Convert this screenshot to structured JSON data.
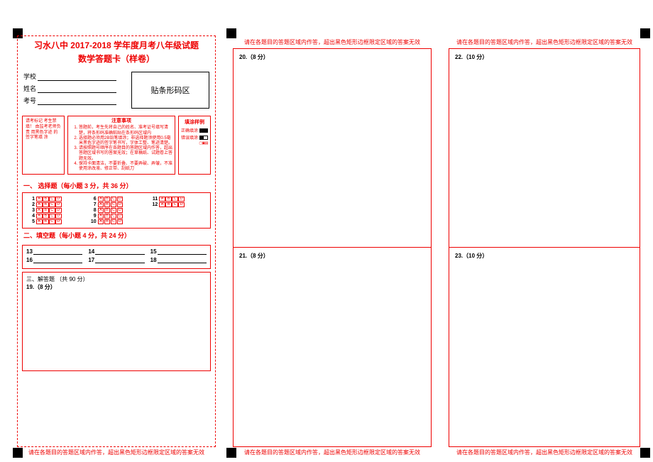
{
  "title_line1": "习水八中 2017-2018 学年度月考八年级试题",
  "title_line2": "数学答题卡（样卷）",
  "info": {
    "school_label": "学校",
    "name_label": "姓名",
    "examno_label": "考号"
  },
  "barcode_label": "贴条形码区",
  "instr_left": "请考标记 考生禁填！ 由监考老师负责 用黑色字迹 的签字笔填 涂",
  "instr_mid_title": "注意事项",
  "instr_mid": [
    "答题前，考生先将自己的姓名、准考证号填写清楚，将条形码准确粘贴在条形码区域内",
    "选择题必须用2B铅笔填涂；非选择题须使用0.5毫米黑色字迹的签字笔书写，字体工整、笔迹清楚。",
    "请按照题号顺序在各题目的答题区域内作答，超出答题区域书写的答案无效；在草稿纸、试题卷上答题无效。",
    "保持卡面清洁，不要折叠、不要弄破、弄皱，不准使用涂改液、修正带、刮纸刀"
  ],
  "instr_right_title": "填涂样例",
  "fill_examples": {
    "correct": "正确填涂",
    "wrong": "错误填涂"
  },
  "warn_text": "请在各题目的答题区域内作答，超出黑色矩形边框限定区域的答案无效",
  "sections": {
    "mcq_title": "一、 选择题（每小题 3 分，共 36 分）",
    "mcq_items": [
      1,
      2,
      3,
      4,
      5,
      6,
      7,
      8,
      9,
      10,
      11,
      12
    ],
    "bubble_opts": [
      "A",
      "B",
      "C",
      "D"
    ],
    "fill_title": "二、填空题（每小题 4 分，共 24 分）",
    "fill_nums": [
      13,
      14,
      15,
      16,
      17,
      18
    ],
    "ans_title": "三、解答题 （共 90 分）",
    "q19": "19.（8 分）",
    "q20": "20.（8 分）",
    "q21": "21.（8 分）",
    "q22": "22.（10 分）",
    "q23": "23.（10 分）"
  }
}
